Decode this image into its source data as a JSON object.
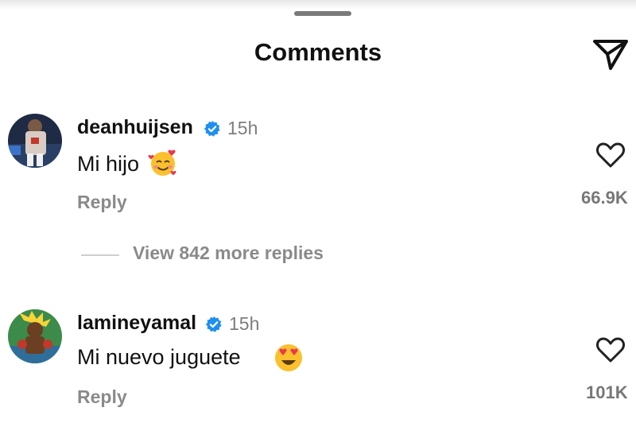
{
  "header": {
    "title": "Comments",
    "send_icon": "send-icon"
  },
  "comments": [
    {
      "username": "deanhuijsen",
      "verified": true,
      "time": "15h",
      "text": "Mi hijo",
      "emoji": "smiling-face-with-hearts",
      "reply_label": "Reply",
      "likes": "66.9K",
      "view_replies": "View 842 more replies"
    },
    {
      "username": "lamineyamal",
      "verified": true,
      "time": "15h",
      "text": "Mi nuevo juguete",
      "emoji": "heart-eyes",
      "reply_label": "Reply",
      "likes": "101K"
    }
  ],
  "colors": {
    "verified": "#1f8ef1",
    "secondary_text": "#8a8a8a",
    "emoji_yellow": "#fbc02d",
    "heart_red": "#e8384f"
  }
}
